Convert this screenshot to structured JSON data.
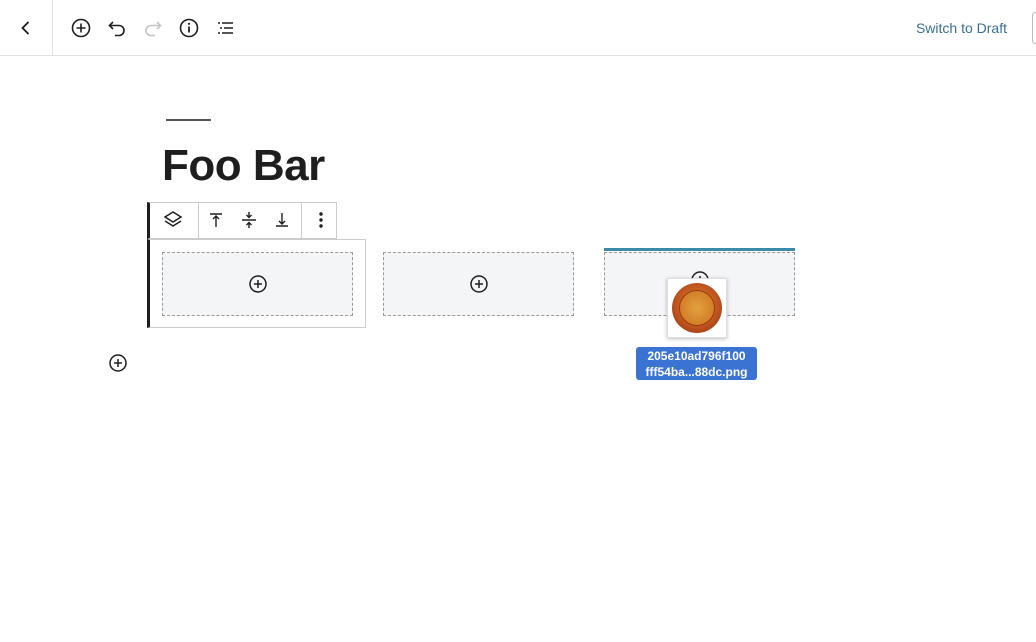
{
  "header": {
    "icons": [
      "back-chevron-icon",
      "add-block-icon",
      "undo-icon",
      "redo-icon",
      "info-icon",
      "list-view-icon"
    ],
    "switch_to_draft": "Switch to Draft"
  },
  "post": {
    "title": "Foo Bar"
  },
  "block_toolbar": {
    "icons": [
      "block-type-icon",
      "align-top-icon",
      "align-center-icon",
      "align-bottom-icon",
      "more-options-icon"
    ]
  },
  "columns": [
    {
      "state": "empty",
      "icon": "add-block-icon"
    },
    {
      "state": "empty",
      "icon": "add-block-icon"
    },
    {
      "state": "drop-target",
      "icon": "add-block-icon"
    }
  ],
  "drag": {
    "file_name_line1": "205e10ad796f100",
    "file_name_line2": "fff54ba...88dc.png"
  },
  "colors": {
    "accent_link": "#3a6f8f",
    "drop_indicator": "#3d8aa8",
    "drag_label_bg": "#3b73d3"
  }
}
